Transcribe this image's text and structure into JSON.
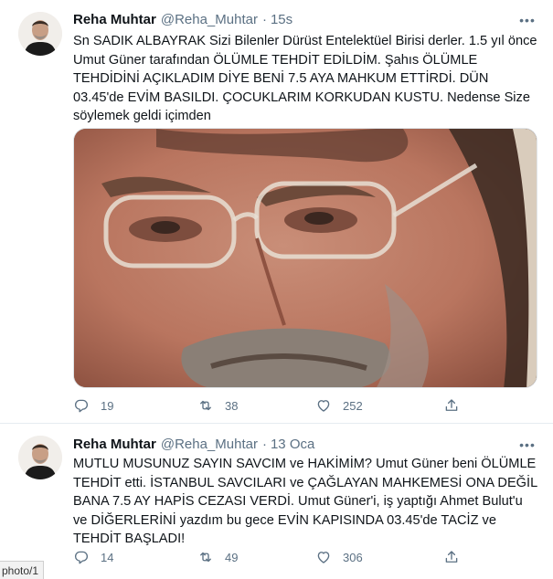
{
  "tweets": [
    {
      "name": "Reha Muhtar",
      "handle": "@Reha_Muhtar",
      "separator": "·",
      "time": "15s",
      "more": "•••",
      "text": "Sn SADIK ALBAYRAK Sizi Bilenler Dürüst Entelektüel Birisi derler. 1.5 yıl önce Umut Güner tarafından ÖLÜMLE TEHDİT EDİLDİM. Şahıs ÖLÜMLE TEHDİDİNİ AÇIKLADIM DİYE BENİ 7.5 AYA MAHKUM ETTİRDİ. DÜN 03.45'de EVİM BASILDI. ÇOCUKLARIM KORKUDAN KUSTU. Nedense Size söylemek geldi içimden",
      "replies": "19",
      "retweets": "38",
      "likes": "252"
    },
    {
      "name": "Reha Muhtar",
      "handle": "@Reha_Muhtar",
      "separator": "·",
      "time": "13 Oca",
      "more": "•••",
      "text": "MUTLU MUSUNUZ SAYIN SAVCIM ve HAKİMİM? Umut Güner beni ÖLÜMLE TEHDİT etti. İSTANBUL SAVCILARI ve ÇAĞLAYAN MAHKEMESİ ONA DEĞİL BANA 7.5 AY HAPİS CEZASI VERDİ. Umut Güner'i, iş yaptığı Ahmet Bulut'u ve DİĞERLERİNİ yazdım bu gece EVİN KAPISINDA 03.45'de TACİZ ve TEHDİT BAŞLADI!",
      "replies": "14",
      "retweets": "49",
      "likes": "306"
    }
  ],
  "url_tag": "photo/1",
  "colors": {
    "text": "#0f1419",
    "secondary": "#5b7083",
    "divider": "#e6ecf0"
  },
  "icons": [
    "reply-icon",
    "retweet-icon",
    "like-icon",
    "share-icon",
    "more-icon"
  ]
}
